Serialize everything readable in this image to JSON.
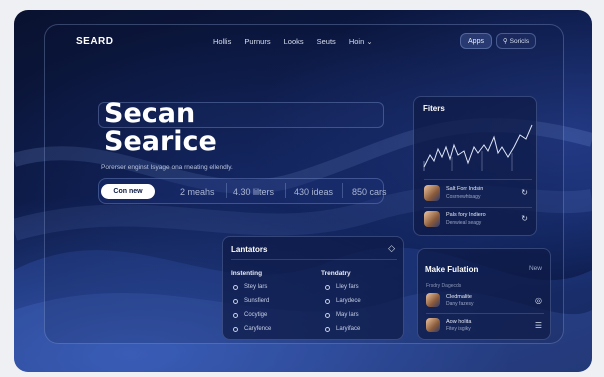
{
  "nav": {
    "logo": "SEARD",
    "links": [
      "Hollis",
      "Purnurs",
      "Looks",
      "Seuts",
      "Hoin"
    ],
    "apps_label": "Apps",
    "search_label": "Soricls"
  },
  "hero": {
    "title_line1": "Secan",
    "title_line2": "Searice",
    "subtitle": "Porerser enginst Isyage ona rneating ellendly.",
    "cta_label": "Con new",
    "stats": [
      "2 meahs",
      "4.30 lilters",
      "430 ideas",
      "850 cars"
    ]
  },
  "filters_panel": {
    "title": "Fiters",
    "items": [
      {
        "name": "Salt Forr Indsin",
        "sub": "Cosrnewhtsagy",
        "icon": "refresh-icon"
      },
      {
        "name": "Pals fory Indiero",
        "sub": "Denwieal seagy",
        "icon": "refresh-icon"
      }
    ]
  },
  "lantators_panel": {
    "title": "Lantators",
    "col1_header": "Instenting",
    "col1_items": [
      "Stey lars",
      "Sunsfierd",
      "Cocytige",
      "Caryfence"
    ],
    "col2_header": "Trendatry",
    "col2_items": [
      "Lley fars",
      "Larydece",
      "May lars",
      "Laryiface"
    ]
  },
  "fulation_panel": {
    "title": "Make Fulation",
    "new_label": "New",
    "subtitle": "Frsdry Dagecds",
    "items": [
      {
        "name": "Cledmalite",
        "sub": "Dany fazesy",
        "icon": "camera-icon"
      },
      {
        "name": "Aow holita",
        "sub": "Fitey isgiky",
        "icon": "list-icon"
      }
    ]
  },
  "colors": {
    "background_dark": "#0a1230",
    "accent_blue": "#2a4cc8",
    "panel_bg": "#0e1a46",
    "text_white": "#ffffff"
  }
}
